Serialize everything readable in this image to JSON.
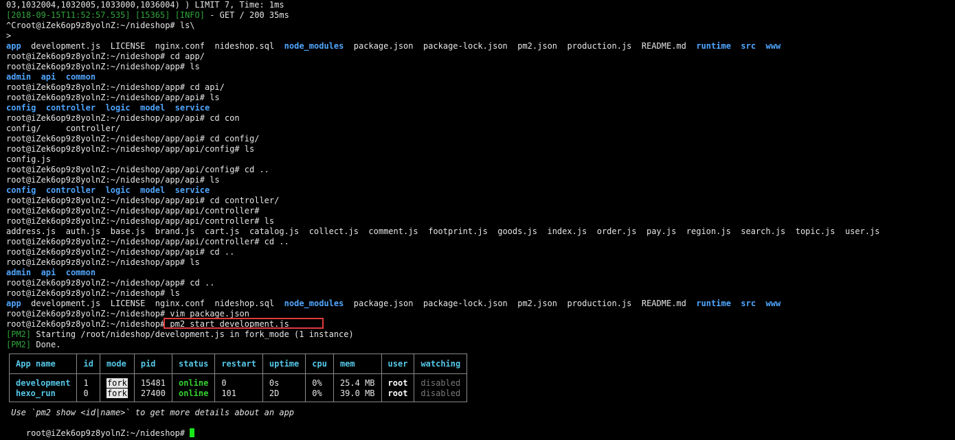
{
  "lines": [
    {
      "t": "03,1032004,1032005,1033000,1036004) ) LIMIT 7, Time: 1ms"
    },
    {
      "log_ts": "[2018-09-15T11:52:57.535] [15365] [INFO]",
      "t": " - GET / 200 35ms"
    },
    {
      "t": "^Croot@iZek6op9z8yolnZ:~/nideshop# ls\\"
    },
    {
      "t": ">"
    },
    {
      "ls_root": true
    },
    {
      "t": "root@iZek6op9z8yolnZ:~/nideshop# cd app/"
    },
    {
      "t": "root@iZek6op9z8yolnZ:~/nideshop/app# ls"
    },
    {
      "ls_app": true
    },
    {
      "t": "root@iZek6op9z8yolnZ:~/nideshop/app# cd api/"
    },
    {
      "t": "root@iZek6op9z8yolnZ:~/nideshop/app/api# ls"
    },
    {
      "ls_api": true
    },
    {
      "t": "root@iZek6op9z8yolnZ:~/nideshop/app/api# cd con"
    },
    {
      "t": "config/     controller/"
    },
    {
      "t": "root@iZek6op9z8yolnZ:~/nideshop/app/api# cd config/"
    },
    {
      "t": "root@iZek6op9z8yolnZ:~/nideshop/app/api/config# ls"
    },
    {
      "t": "config.js"
    },
    {
      "t": "root@iZek6op9z8yolnZ:~/nideshop/app/api/config# cd .."
    },
    {
      "t": "root@iZek6op9z8yolnZ:~/nideshop/app/api# ls"
    },
    {
      "ls_api": true
    },
    {
      "t": "root@iZek6op9z8yolnZ:~/nideshop/app/api# cd controller/"
    },
    {
      "t": "root@iZek6op9z8yolnZ:~/nideshop/app/api/controller#"
    },
    {
      "t": "root@iZek6op9z8yolnZ:~/nideshop/app/api/controller# ls"
    },
    {
      "t": "address.js  auth.js  base.js  brand.js  cart.js  catalog.js  collect.js  comment.js  footprint.js  goods.js  index.js  order.js  pay.js  region.js  search.js  topic.js  user.js"
    },
    {
      "t": "root@iZek6op9z8yolnZ:~/nideshop/app/api/controller# cd .."
    },
    {
      "t": "root@iZek6op9z8yolnZ:~/nideshop/app/api# cd .."
    },
    {
      "t": "root@iZek6op9z8yolnZ:~/nideshop/app# ls"
    },
    {
      "ls_app": true
    },
    {
      "t": "root@iZek6op9z8yolnZ:~/nideshop/app# cd .."
    },
    {
      "t": "root@iZek6op9z8yolnZ:~/nideshop# ls"
    },
    {
      "ls_root": true
    },
    {
      "t": "root@iZek6op9z8yolnZ:~/nideshop# vim package.json"
    },
    {
      "t": "root@iZek6op9z8yolnZ:~/nideshop# pm2 start development.js",
      "highlight": true
    },
    {
      "pm2": "[PM2]",
      "t": " Starting /root/nideshop/development.js in fork_mode (1 instance)"
    },
    {
      "pm2": "[PM2]",
      "t": " Done."
    }
  ],
  "ls_root": [
    {
      "name": "app",
      "dir": true
    },
    {
      "name": "development.js",
      "dir": false
    },
    {
      "name": "LICENSE",
      "dir": false
    },
    {
      "name": "nginx.conf",
      "dir": false
    },
    {
      "name": "nideshop.sql",
      "dir": false
    },
    {
      "name": "node_modules",
      "dir": true
    },
    {
      "name": "package.json",
      "dir": false
    },
    {
      "name": "package-lock.json",
      "dir": false
    },
    {
      "name": "pm2.json",
      "dir": false
    },
    {
      "name": "production.js",
      "dir": false
    },
    {
      "name": "README.md",
      "dir": false
    },
    {
      "name": "runtime",
      "dir": true
    },
    {
      "name": "src",
      "dir": true
    },
    {
      "name": "www",
      "dir": true
    }
  ],
  "ls_app": [
    "admin",
    "api",
    "common"
  ],
  "ls_api": [
    "config",
    "controller",
    "logic",
    "model",
    "service"
  ],
  "pm2_table": {
    "headers": [
      "App name",
      "id",
      "mode",
      "pid",
      "status",
      "restart",
      "uptime",
      "cpu",
      "mem",
      "user",
      "watching"
    ],
    "rows": [
      {
        "name": "development",
        "id": "1",
        "mode": "fork",
        "pid": "15481",
        "status": "online",
        "restart": "0",
        "uptime": "0s",
        "cpu": "0%",
        "mem": "25.4 MB",
        "user": "root",
        "watching": "disabled"
      },
      {
        "name": "hexo_run",
        "id": "0",
        "mode": "fork",
        "pid": "27400",
        "status": "online",
        "restart": "101",
        "uptime": "2D",
        "cpu": "0%",
        "mem": "39.0 MB",
        "user": "root",
        "watching": "disabled"
      }
    ]
  },
  "hint": " Use `pm2 show <id|name>` to get more details about an app",
  "final_prompt": "root@iZek6op9z8yolnZ:~/nideshop# ",
  "colors": {
    "background": "#000000",
    "directory": "#4fa6ff",
    "pm2_tag": "#2fa53a",
    "online": "#34d12f",
    "header": "#55c7e8",
    "highlight_box": "#e23b3b",
    "cursor": "#19e619"
  }
}
